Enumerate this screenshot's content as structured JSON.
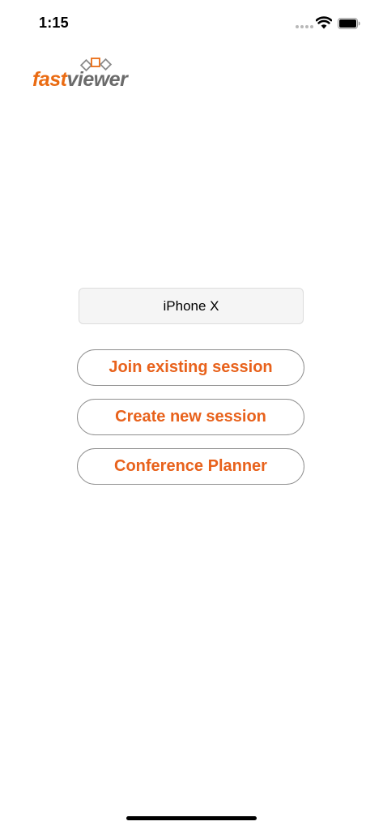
{
  "status_bar": {
    "time": "1:15"
  },
  "logo": {
    "part1": "fast",
    "part2": "viewer",
    "colors": {
      "fast": "#ea6b12",
      "viewer": "#6b6b6b"
    }
  },
  "device": {
    "name": "iPhone X"
  },
  "buttons": {
    "join": "Join existing session",
    "create": "Create new session",
    "conference": "Conference Planner"
  },
  "theme": {
    "accent": "#e8621c",
    "button_border": "#8e8e8e",
    "field_background": "#f5f5f5"
  },
  "icons": [
    "cellular-signal-icon",
    "wifi-icon",
    "battery-icon"
  ]
}
